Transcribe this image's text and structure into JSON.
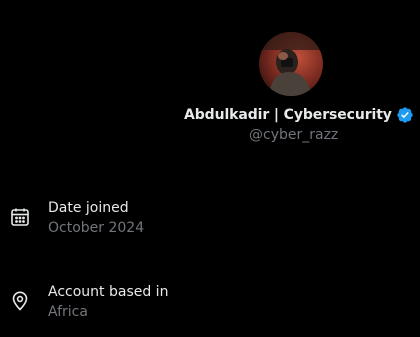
{
  "profile": {
    "display_name": "Abdulkadir | Cybersecurity",
    "handle": "@cyber_razz",
    "verified_icon": "verified-badge-icon",
    "verified_color": "#1d9bf0"
  },
  "details": [
    {
      "icon": "calendar-icon",
      "title": "Date joined",
      "value": "October 2024"
    },
    {
      "icon": "location-pin-icon",
      "title": "Account based in",
      "value": "Africa"
    }
  ],
  "colors": {
    "background": "#000000",
    "primary_text": "#e7e9ea",
    "secondary_text": "#71767b"
  }
}
